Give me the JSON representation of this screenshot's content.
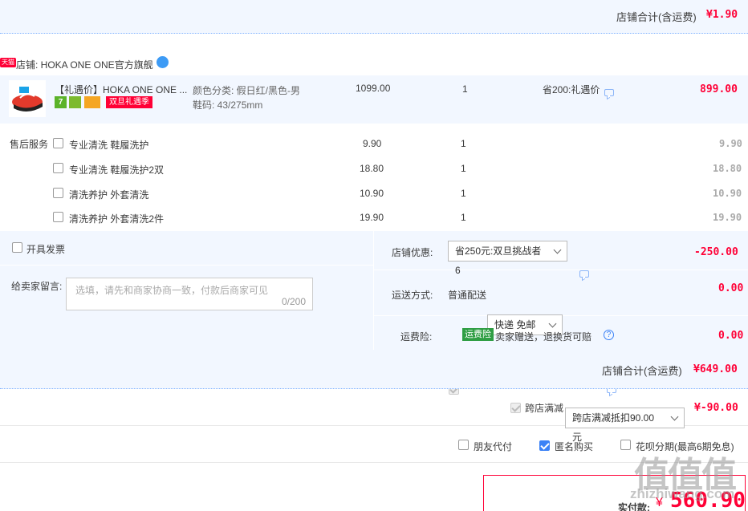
{
  "top_total": {
    "label": "店铺合计(含运费)",
    "value": "¥1.90"
  },
  "store": {
    "tmall_badge": "天猫",
    "name": "店铺: HOKA ONE ONE官方旗舰",
    "ww_icon": "wangwang-chat-icon"
  },
  "product": {
    "title": "【礼遇价】HOKA ONE ONE ...",
    "attr1": "颜色分类: 假日红/黑色-男",
    "attr2": "鞋码: 43/275mm",
    "badge_7": "7",
    "promo_badge": "双旦礼遇季",
    "unit_price": "1099.00",
    "qty": "1",
    "discount": "省200:礼遇价",
    "subtotal": "899.00"
  },
  "services": {
    "section_label": "售后服务",
    "items": [
      {
        "name": "专业清洗 鞋履洗护",
        "price": "9.90",
        "qty": "1",
        "subtotal": "9.90"
      },
      {
        "name": "专业清洗 鞋履洗护2双",
        "price": "18.80",
        "qty": "1",
        "subtotal": "18.80"
      },
      {
        "name": "清洗养护 外套清洗",
        "price": "10.90",
        "qty": "1",
        "subtotal": "10.90"
      },
      {
        "name": "清洗养护 外套清洗2件",
        "price": "19.90",
        "qty": "1",
        "subtotal": "19.90"
      }
    ]
  },
  "invoice": {
    "label": "开具发票"
  },
  "message": {
    "label": "给卖家留言:",
    "placeholder": "选填，请先和商家协商一致，付款后商家可见",
    "counter": "0/200"
  },
  "coupon": {
    "label": "店铺优惠:",
    "selected": "省250元:双旦挑战者6",
    "amount": "-250.00"
  },
  "shipping": {
    "label": "运送方式:",
    "method": "普通配送",
    "selected": "快递 免邮",
    "amount": "0.00"
  },
  "insurance": {
    "label": "运费险:",
    "badge": "运费险",
    "text": "卖家赠送，退换货可赔",
    "amount": "0.00"
  },
  "store_total": {
    "label": "店铺合计(含运费)",
    "value": "¥649.00"
  },
  "cross_store": {
    "label": "跨店满减",
    "selected": "跨店满减抵扣90.00元",
    "amount": "¥-90.00"
  },
  "options": {
    "friend_pay": "朋友代付",
    "anonymous": "匿名购买",
    "huabei": "花呗分期(最高6期免息)"
  },
  "payment": {
    "label": "实付款:",
    "currency": "¥",
    "value": "560.90"
  },
  "watermark": {
    "text": "值值值",
    "site": "zhizhiwang.com"
  }
}
